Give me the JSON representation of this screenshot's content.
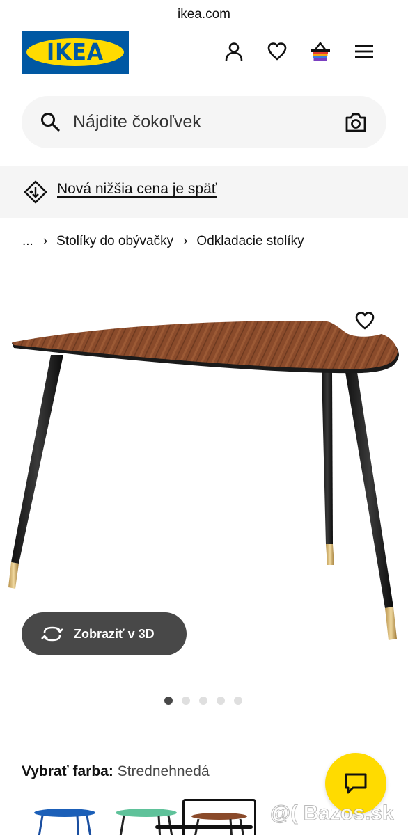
{
  "browser": {
    "url": "ikea.com"
  },
  "header": {
    "logo_text": "IKEA",
    "icons": [
      "user-icon",
      "heart-icon",
      "basket-icon",
      "menu-icon"
    ],
    "colors": {
      "logo_blue": "#0058a3",
      "logo_yellow": "#ffdb00"
    }
  },
  "search": {
    "placeholder": "Nájdite čokoľvek",
    "value": ""
  },
  "promo": {
    "text": "Nová nižšia cena je späť"
  },
  "breadcrumb": {
    "items": [
      {
        "label": "..."
      },
      {
        "label": "Stolíky do obývačky"
      },
      {
        "label": "Odkladacie stolíky"
      }
    ]
  },
  "product": {
    "image_description": "Odkladací stolík, strednehnedá doska, čierne nohy",
    "view_3d_label": "Zobraziť v 3D",
    "carousel": {
      "total": 5,
      "active": 1
    },
    "color_select": {
      "label": "Vybrať farba:",
      "value": "Strednehnedá",
      "swatches": [
        {
          "name": "blue",
          "color": "#1b5fb8"
        },
        {
          "name": "green",
          "color": "#5fc29a"
        },
        {
          "name": "brown",
          "color": "#8a4a2a",
          "selected": true
        }
      ]
    }
  },
  "chat": {
    "icon": "chat-icon",
    "color": "#ffdb00"
  },
  "watermark": {
    "text": "@( Bazos.sk"
  }
}
